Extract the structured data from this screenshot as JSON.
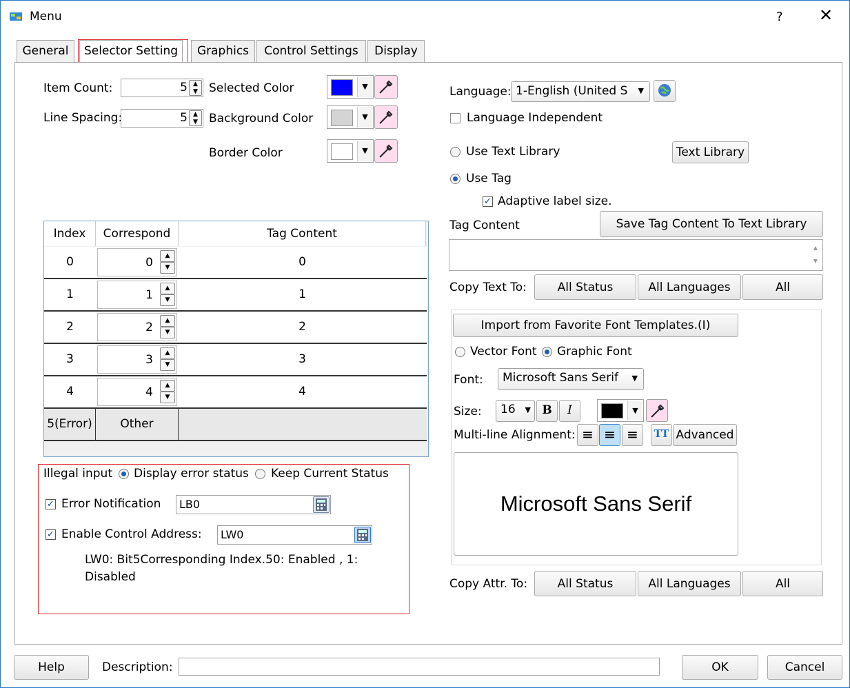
{
  "window": {
    "title": "Menu",
    "help_glyph": "?",
    "close_glyph": "✕"
  },
  "tabs": [
    "General",
    "Selector Setting",
    "Graphics",
    "Control Settings",
    "Display"
  ],
  "left": {
    "item_count_label": "Item Count:",
    "item_count": "5",
    "line_spacing_label": "Line Spacing:",
    "line_spacing": "5",
    "selected_color_label": "Selected Color",
    "background_color_label": "Background Color",
    "border_color_label": "Border Color",
    "colors": {
      "selected": "#0000ff",
      "background": "#d4d4d4",
      "border": "#ffffff"
    }
  },
  "table": {
    "headers": [
      "Index",
      "Correspond",
      "Tag Content"
    ],
    "rows": [
      {
        "index": "0",
        "correspond": "0",
        "tag": "0"
      },
      {
        "index": "1",
        "correspond": "1",
        "tag": "1"
      },
      {
        "index": "2",
        "correspond": "2",
        "tag": "2"
      },
      {
        "index": "3",
        "correspond": "3",
        "tag": "3"
      },
      {
        "index": "4",
        "correspond": "4",
        "tag": "4"
      }
    ],
    "error_row": {
      "index": "5(Error)",
      "correspond": "Other",
      "tag": ""
    }
  },
  "illegal": {
    "label": "Illegal input",
    "option_display": "Display error status",
    "option_keep": "Keep Current Status",
    "error_notification_label": "Error Notification",
    "error_notification_value": "LB0",
    "enable_control_label": "Enable Control Address:",
    "enable_control_value": "LW0",
    "note_line1": "LW0:  Bit5Corresponding Index.50: Enabled , 1:",
    "note_line2": "Disabled"
  },
  "right": {
    "language_label": "Language:",
    "language_value": "1-English (United S",
    "language_independent": "Language Independent",
    "use_text_library": "Use Text Library",
    "text_library_button": "Text Library",
    "use_tag": "Use Tag",
    "adaptive_label": "Adaptive label size.",
    "tag_content_label": "Tag Content",
    "save_tag_button": "Save Tag Content To Text Library",
    "copy_text_label": "Copy Text To:",
    "all_status": "All Status",
    "all_languages": "All Languages",
    "all": "All",
    "import_button": "Import from Favorite Font Templates.(I)",
    "vector_font": "Vector Font",
    "graphic_font": "Graphic Font",
    "font_label": "Font:",
    "font_value": "Microsoft Sans Serif",
    "size_label": "Size:",
    "size_value": "16",
    "bold": "B",
    "italic": "I",
    "font_color": "#000000",
    "multiline_label": "Multi-line Alignment:",
    "tt_glyph": "TT",
    "advanced_button": "Advanced",
    "preview_text": "Microsoft Sans Serif",
    "copy_attr_label": "Copy Attr. To:"
  },
  "footer": {
    "help": "Help",
    "description_label": "Description:",
    "ok": "OK",
    "cancel": "Cancel"
  }
}
